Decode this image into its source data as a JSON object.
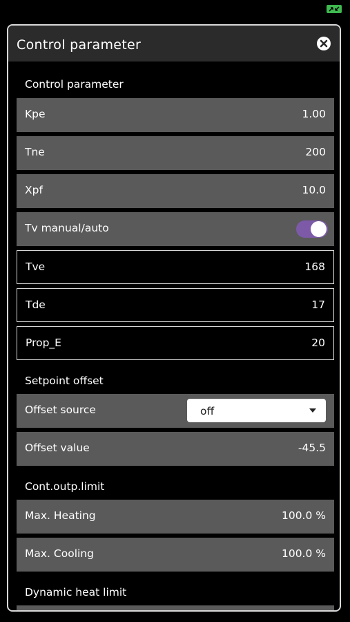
{
  "status_bar": {
    "icon": "expand-icon",
    "accent_color": "#3fb950"
  },
  "dialog": {
    "title": "Control parameter",
    "close_icon": "close-circle-icon"
  },
  "sections": {
    "control_parameter": {
      "label": "Control parameter",
      "rows": [
        {
          "label": "Kpe",
          "value": "1.00"
        },
        {
          "label": "Tne",
          "value": "200"
        },
        {
          "label": "Xpf",
          "value": "10.0"
        }
      ],
      "toggle": {
        "label": "Tv manual/auto",
        "on": true,
        "color": "#7d5aa8"
      },
      "outlined_rows": [
        {
          "label": "Tve",
          "value": "168"
        },
        {
          "label": "Tde",
          "value": "17"
        },
        {
          "label": "Prop_E",
          "value": "20"
        }
      ]
    },
    "setpoint_offset": {
      "label": "Setpoint offset",
      "offset_source": {
        "label": "Offset source",
        "selected": "off"
      },
      "offset_value": {
        "label": "Offset value",
        "value": "-45.5"
      }
    },
    "output_limit": {
      "label": "Cont.outp.limit",
      "rows": [
        {
          "label": "Max. Heating",
          "value": "100.0 %"
        },
        {
          "label": "Max. Cooling",
          "value": "100.0 %"
        }
      ]
    },
    "dynamic_heat_limit": {
      "label": "Dynamic heat limit"
    }
  },
  "colors": {
    "row_background": "#5a5a5a",
    "header_background": "#2b2b2b",
    "border": "#d9d9d9"
  }
}
